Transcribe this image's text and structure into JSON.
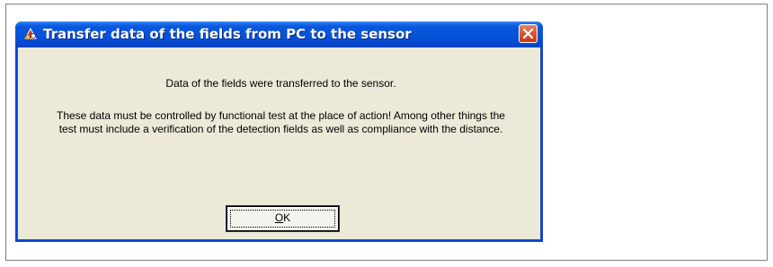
{
  "dialog": {
    "title": "Transfer data of the fields from PC to the sensor",
    "icon": "sensor-app-icon",
    "close_icon": "close-icon",
    "close_color": "#d9502d",
    "titlebar_color": "#0553d9",
    "body_color": "#ece9d8",
    "message_line1": "Data of the fields were transferred to the sensor.",
    "message_paragraph2": "These data must be controlled by functional test at the place of action! Among other things the test must include a verification of the detection fields as well as compliance with the distance.",
    "ok_button": {
      "mnemonic": "O",
      "rest": "K"
    }
  }
}
